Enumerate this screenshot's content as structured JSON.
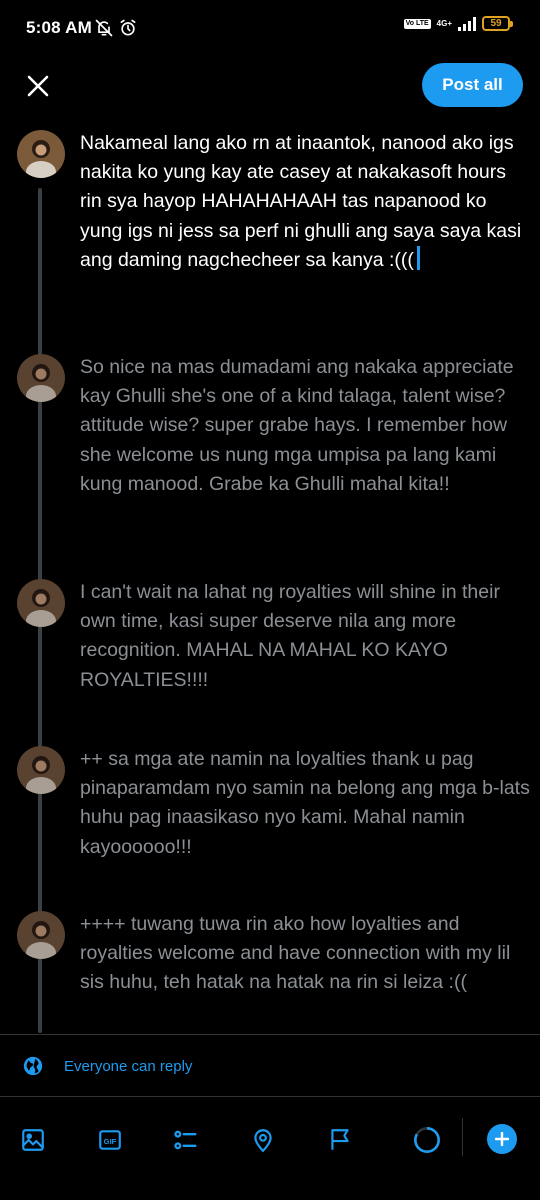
{
  "status_bar": {
    "time": "5:08 AM",
    "volte": "Vo LTE",
    "network": "4G+",
    "battery": "59",
    "icons": [
      "bell-off-icon",
      "alarm-icon",
      "signal-icon",
      "battery-icon"
    ]
  },
  "header": {
    "close_icon": "close-icon",
    "post_all_label": "Post all"
  },
  "thread": [
    {
      "text": "Nakameal lang ako rn at inaantok, nanood ako igs nakita ko yung kay ate casey at nakakasoft hours rin sya hayop HAHAHAHAAH tas napanood ko yung igs ni jess sa perf ni ghulli ang saya saya kasi ang daming nagchecheer sa kanya :(((",
      "active": true
    },
    {
      "text": "So nice na mas dumadami ang nakaka appreciate kay Ghulli she's one of a kind talaga, talent wise? attitude wise? super grabe hays. I remember how she welcome us nung mga umpisa pa lang kami kung manood. Grabe ka Ghulli mahal kita!!",
      "active": false
    },
    {
      "text": "I can't wait na lahat ng royalties will shine in their own time, kasi super deserve nila ang more recognition. MAHAL NA MAHAL KO KAYO ROYALTIES!!!!",
      "active": false
    },
    {
      "text": "++ sa mga ate namin na loyalties thank u pag pinaparamdam nyo samin na belong ang mga b-lats huhu pag inaasikaso nyo kami. Mahal namin kayoooooo!!!",
      "active": false
    },
    {
      "text": "++++ tuwang tuwa rin ako how loyalties and royalties welcome and have connection with my lil sis huhu, teh hatak na hatak na rin si leiza :((",
      "active": false
    }
  ],
  "reply_setting": {
    "icon": "globe-icon",
    "label": "Everyone can reply"
  },
  "toolbar": {
    "items": [
      "image-icon",
      "gif-icon",
      "poll-icon",
      "location-icon",
      "flag-icon",
      "char-counter-icon",
      "add-post-icon"
    ],
    "gif_label": "GIF"
  },
  "colors": {
    "accent": "#1d9bf0",
    "background": "#000000",
    "active_text": "#ffffff",
    "dim_text": "#8b9095",
    "battery": "#e0a225"
  }
}
